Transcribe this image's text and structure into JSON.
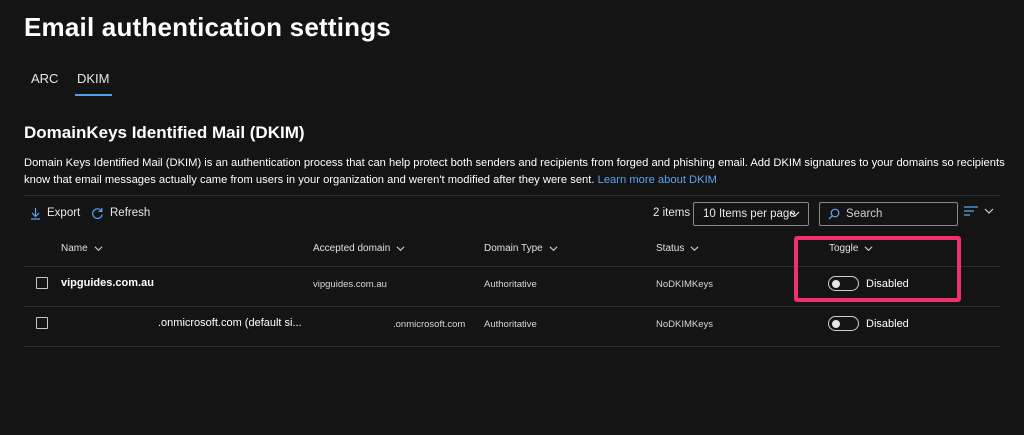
{
  "page": {
    "title": "Email authentication settings"
  },
  "tabs": [
    {
      "label": "ARC",
      "active": false
    },
    {
      "label": "DKIM",
      "active": true
    }
  ],
  "section": {
    "title": "DomainKeys Identified Mail (DKIM)",
    "description": "Domain Keys Identified Mail (DKIM) is an authentication process that can help protect both senders and recipients from forged and phishing email. Add DKIM signatures to your domains so recipients know that email messages actually came from users in your organization and weren't modified after they were sent.",
    "link_text": "Learn more about DKIM"
  },
  "toolbar": {
    "export_label": "Export",
    "refresh_label": "Refresh",
    "item_count": "2 items",
    "page_size": "10 Items per page",
    "search_placeholder": "Search"
  },
  "table": {
    "columns": [
      "Name",
      "Accepted domain",
      "Domain Type",
      "Status",
      "Toggle"
    ],
    "rows": [
      {
        "name": "vipguides.com.au",
        "accepted_domain": "vipguides.com.au",
        "domain_type": "Authoritative",
        "status": "NoDKIMKeys",
        "toggle": "Disabled"
      },
      {
        "name": ".onmicrosoft.com (default si...",
        "accepted_domain": ".onmicrosoft.com",
        "domain_type": "Authoritative",
        "status": "NoDKIMKeys",
        "toggle": "Disabled"
      }
    ]
  },
  "colors": {
    "background": "#141414",
    "accent": "#4f9fe8",
    "link": "#5aa5ee",
    "highlight": "#f0306a"
  }
}
